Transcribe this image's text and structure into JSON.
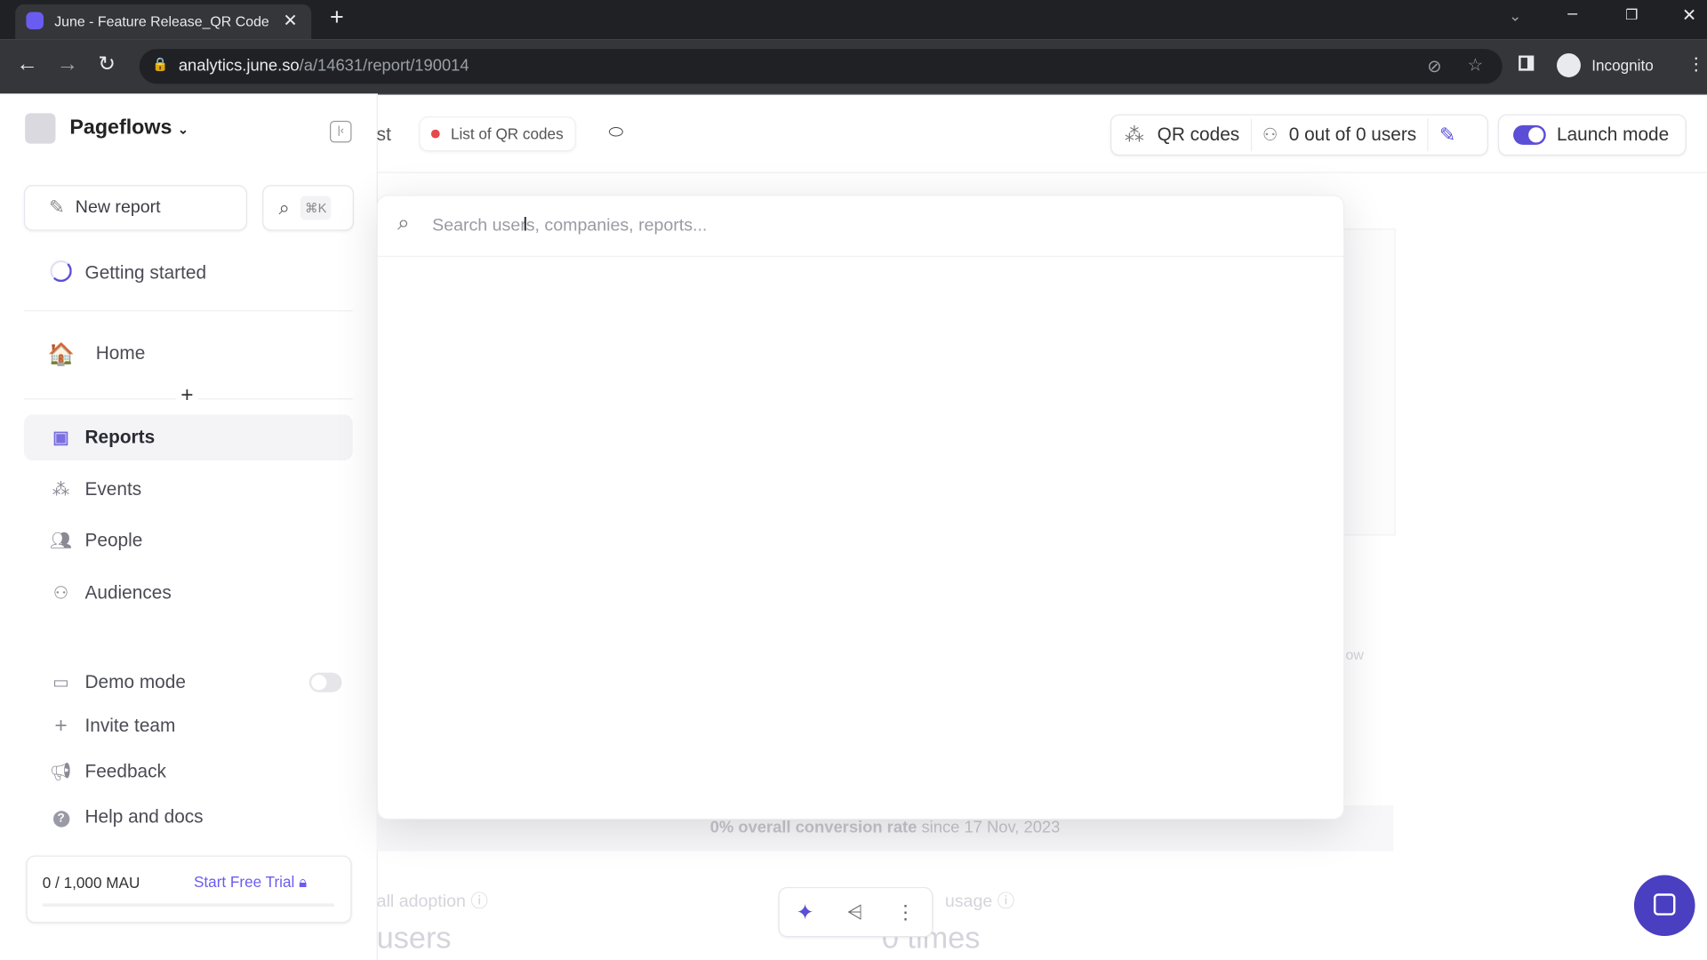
{
  "browser": {
    "tab_title": "June - Feature Release_QR Code",
    "url_domain": "analytics.june.so",
    "url_path": "/a/14631/report/190014",
    "profile": "Incognito"
  },
  "sidebar": {
    "workspace": "Pageflows",
    "new_report": "New report",
    "search_shortcut": "⌘K",
    "getting_started": "Getting started",
    "home": "Home",
    "items": [
      {
        "label": "Reports",
        "icon": "chart-board-icon",
        "active": true
      },
      {
        "label": "Events",
        "icon": "sparkle-cursor-icon"
      },
      {
        "label": "People",
        "icon": "people-icon"
      },
      {
        "label": "Audiences",
        "icon": "audience-icon"
      }
    ],
    "demo_mode": "Demo mode",
    "demo_mode_on": false,
    "invite_team": "Invite team",
    "feedback": "Feedback",
    "help": "Help and docs",
    "mau": "0 / 1,000 MAU",
    "mau_progress": 0,
    "trial": "Start Free Trial"
  },
  "topbar": {
    "partial_title": "st",
    "list_pill": "List of QR codes",
    "event": "QR codes",
    "users": "0 out of 0 users",
    "launch_mode": "Launch mode",
    "launch_mode_on": true
  },
  "search": {
    "placeholder": "Search users, companies, reports..."
  },
  "background": {
    "conversion_bold": "0% overall conversion rate",
    "conversion_rest": " since 17 Nov, 2023",
    "adoption": "all adoption",
    "usage": "usage",
    "users_value": "users",
    "times_value": "0 times",
    "faint_text": "ow"
  },
  "colors": {
    "accent": "#5b4fd6",
    "chat": "#4a3fc0",
    "pill_dot": "#e5484d"
  }
}
